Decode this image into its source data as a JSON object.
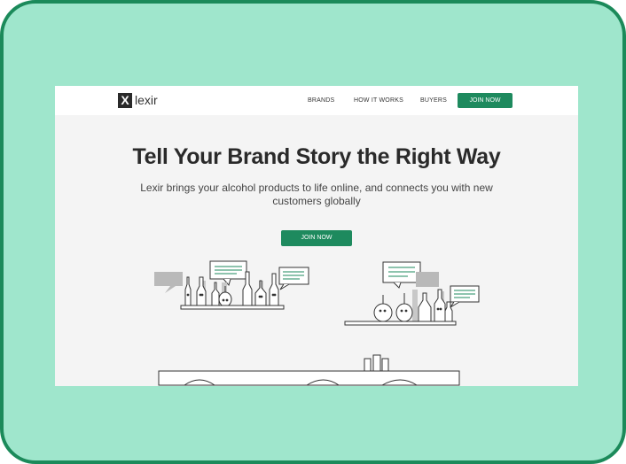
{
  "nav": {
    "logo_mark": "X",
    "logo_text": "lexir",
    "links": [
      {
        "label": "BRANDS"
      },
      {
        "label": "HOW IT WORKS"
      },
      {
        "label": "BUYERS"
      }
    ],
    "cta_label": "JOIN NOW"
  },
  "hero": {
    "title": "Tell Your Brand Story the Right Way",
    "subtitle": "Lexir brings your alcohol products to life online, and connects you with new customers globally",
    "cta_label": "JOIN NOW"
  },
  "colors": {
    "frame_background": "#9fe6cc",
    "frame_border": "#1b8a5a",
    "accent_green": "#1e8a5e",
    "page_background": "#f4f4f4"
  }
}
